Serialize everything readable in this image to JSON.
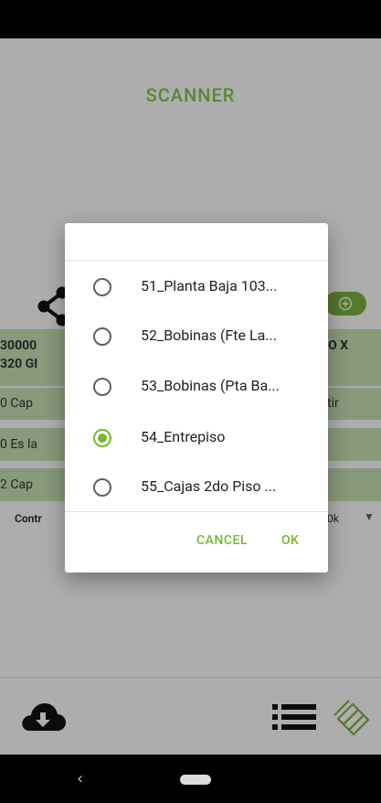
{
  "app": {
    "title": "SCANNER"
  },
  "background": {
    "row1_left_line1": "30000",
    "row1_left_line2": "320 GI",
    "row1_right": "IO X",
    "row2_left": "0 Cap",
    "row2_right": "tir",
    "row3_left": "0 Es la",
    "row4_left": "2 Cap",
    "ctrl_left": "Contr",
    "ctrl_right": "0k"
  },
  "dialog": {
    "options": [
      {
        "label": "51_Planta Baja 103...",
        "selected": false
      },
      {
        "label": "52_Bobinas (Fte La...",
        "selected": false
      },
      {
        "label": "53_Bobinas (Pta Ba...",
        "selected": false
      },
      {
        "label": "54_Entrepiso",
        "selected": true
      },
      {
        "label": "55_Cajas 2do Piso ...",
        "selected": false
      }
    ],
    "cancel_label": "CANCEL",
    "ok_label": "OK"
  },
  "icons": {
    "share": "share-icon",
    "add": "add-circle-icon",
    "cloud_download": "cloud-download-icon",
    "list": "list-icon",
    "logo": "app-logo-icon",
    "back": "back-icon",
    "home": "home-pill-icon"
  },
  "colors": {
    "accent": "#76b82a",
    "bar_bg": "#c9e3b6",
    "title_green": "#8bc34a"
  }
}
